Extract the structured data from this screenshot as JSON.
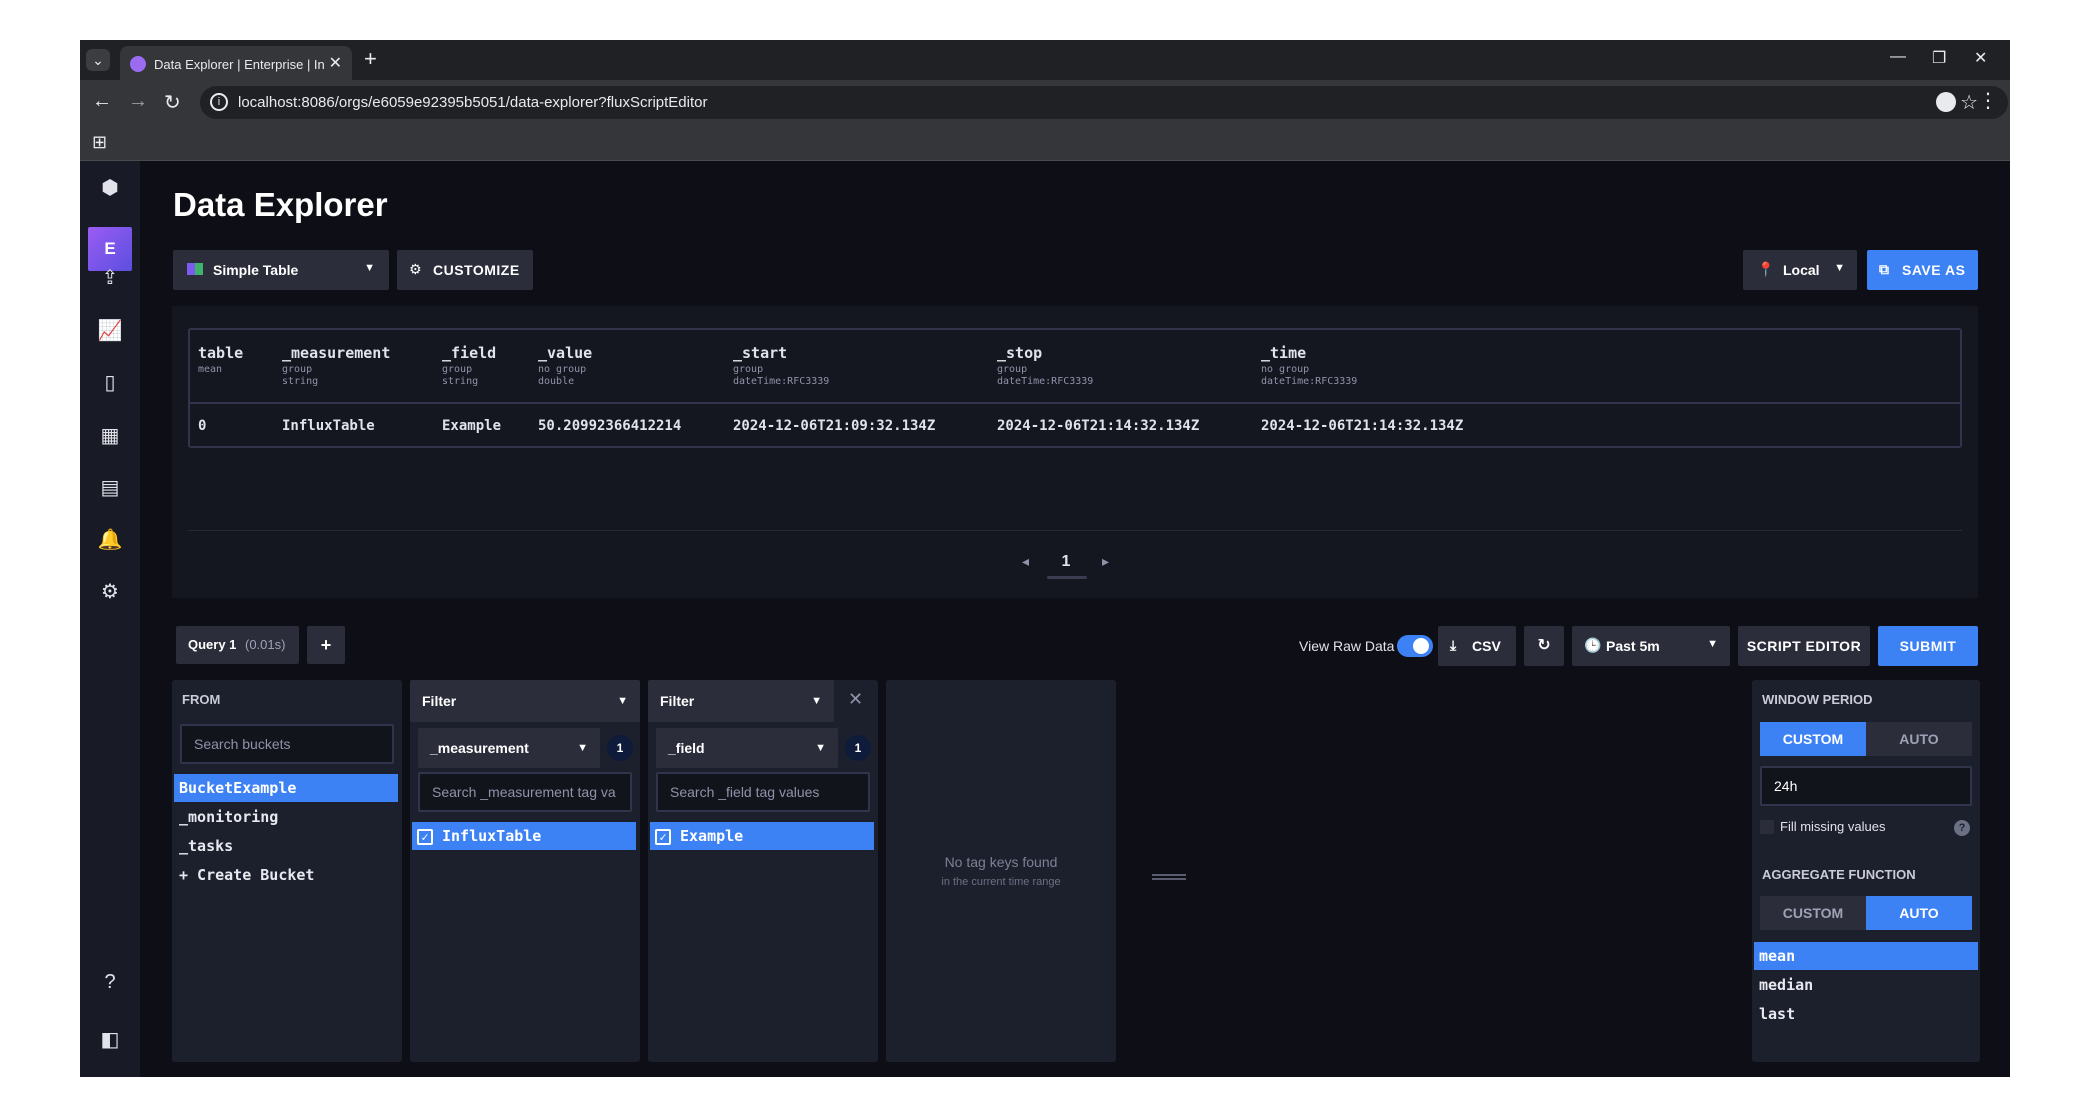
{
  "browser": {
    "tab_title": "Data Explorer | Enterprise | Influ",
    "url": "localhost:8086/orgs/e6059e92395b5051/data-explorer?fluxScriptEditor"
  },
  "nav": {
    "org_initial": "E"
  },
  "page": {
    "title": "Data Explorer"
  },
  "toolbar": {
    "viz_type": "Simple Table",
    "customize": "CUSTOMIZE",
    "timezone": "Local",
    "save_as": "SAVE AS"
  },
  "table": {
    "columns": [
      {
        "name": "table",
        "sub1": "mean",
        "sub2": ""
      },
      {
        "name": "_measurement",
        "sub1": "group",
        "sub2": "string"
      },
      {
        "name": "_field",
        "sub1": "group",
        "sub2": "string"
      },
      {
        "name": "_value",
        "sub1": "no group",
        "sub2": "double"
      },
      {
        "name": "_start",
        "sub1": "group",
        "sub2": "dateTime:RFC3339"
      },
      {
        "name": "_stop",
        "sub1": "group",
        "sub2": "dateTime:RFC3339"
      },
      {
        "name": "_time",
        "sub1": "no group",
        "sub2": "dateTime:RFC3339"
      }
    ],
    "rows": [
      [
        "0",
        "InfluxTable",
        "Example",
        "50.20992366412214",
        "2024-12-06T21:09:32.134Z",
        "2024-12-06T21:14:32.134Z",
        "2024-12-06T21:14:32.134Z"
      ]
    ],
    "page": "1"
  },
  "query_bar": {
    "query_tab": "Query 1",
    "query_time": "(0.01s)",
    "add": "+",
    "view_raw_label": "View Raw Data",
    "view_raw_on": true,
    "csv": "CSV",
    "time_range": "Past 5m",
    "script_editor": "SCRIPT EDITOR",
    "submit": "SUBMIT"
  },
  "from_card": {
    "title": "FROM",
    "search_placeholder": "Search buckets",
    "buckets": [
      "BucketExample",
      "_monitoring",
      "_tasks",
      "+ Create Bucket"
    ],
    "selected": "BucketExample"
  },
  "filter1": {
    "title": "Filter",
    "key": "_measurement",
    "count": "1",
    "search_placeholder": "Search _measurement tag va",
    "values": [
      "InfluxTable"
    ]
  },
  "filter2": {
    "title": "Filter",
    "key": "_field",
    "count": "1",
    "search_placeholder": "Search _field tag values",
    "values": [
      "Example"
    ]
  },
  "empty_card": {
    "line1": "No tag keys found",
    "line2": "in the current time range"
  },
  "window_period": {
    "title": "WINDOW PERIOD",
    "custom": "CUSTOM",
    "auto": "AUTO",
    "active": "custom",
    "value": "24h",
    "fill_missing": "Fill missing values",
    "help": "?"
  },
  "aggregate": {
    "title": "AGGREGATE FUNCTION",
    "custom": "CUSTOM",
    "auto": "AUTO",
    "active": "auto",
    "functions": [
      "mean",
      "median",
      "last"
    ],
    "selected": "mean"
  },
  "colors": {
    "accent": "#3d82f5",
    "panel": "#1c1f2c",
    "background": "#0e0f16"
  }
}
